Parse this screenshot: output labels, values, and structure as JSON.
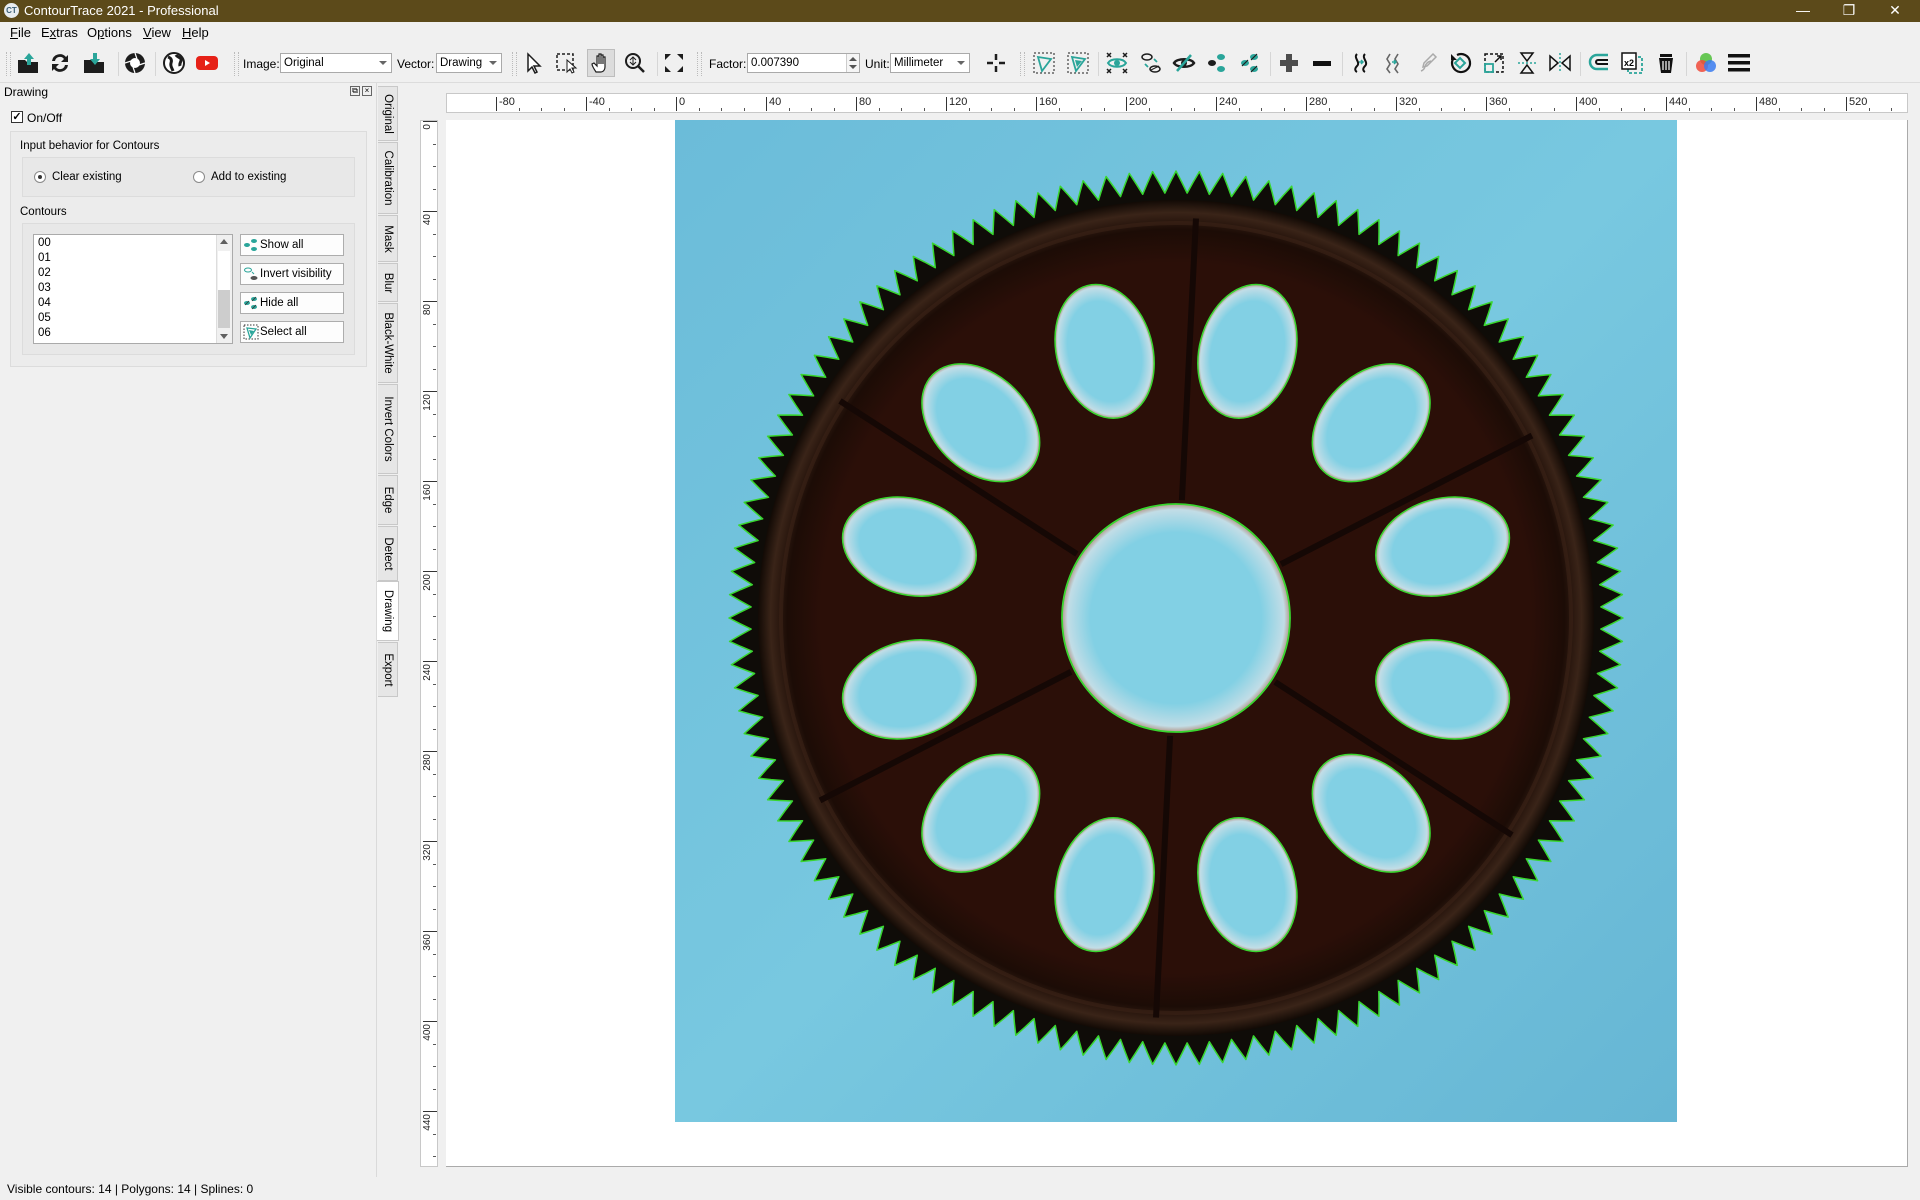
{
  "window": {
    "title": "ContourTrace 2021 - Professional",
    "app_icon_text": "CT",
    "controls": {
      "minimize": "—",
      "restore": "❐",
      "close": "✕"
    }
  },
  "menu": {
    "items": [
      {
        "label": "File",
        "mnemonic": "F"
      },
      {
        "label": "Extras",
        "mnemonic": "x"
      },
      {
        "label": "Options",
        "mnemonic": "p"
      },
      {
        "label": "View",
        "mnemonic": "V"
      },
      {
        "label": "Help",
        "mnemonic": "H"
      }
    ]
  },
  "toolbar": {
    "image_label": "Image:",
    "image_value": "Original",
    "vector_label": "Vector:",
    "vector_value": "Drawing",
    "factor_label": "Factor:",
    "factor_value": "0.007390",
    "unit_label": "Unit:",
    "unit_value": "Millimeter",
    "icons": [
      "open-image-icon",
      "reload-icon",
      "save-icon",
      "aperture-icon",
      "globe-icon",
      "youtube-icon",
      "pointer-icon",
      "select-rect-icon",
      "hand-pan-icon",
      "zoom-icon",
      "fit-to-window-icon",
      "crosshair-icon",
      "polygon-select-icon",
      "polygon-inner-select-icon",
      "show-all-contours-icon",
      "invert-visibility-icon",
      "hide-contour-icon",
      "show-contour-points-icon",
      "hide-contour-points-icon",
      "add-icon",
      "remove-icon",
      "spline-convert-icon",
      "polygon-convert-icon",
      "edit-curve-icon",
      "rotate-icon",
      "scale-icon",
      "flip-vertical-icon",
      "flip-horizontal-icon",
      "offset-icon",
      "duplicate-icon",
      "delete-icon",
      "color-icon",
      "menu-icon"
    ],
    "active_tool": "hand-pan-icon"
  },
  "panel": {
    "title": "Drawing",
    "onoff_label": "On/Off",
    "onoff_checked": true,
    "input_behavior": {
      "title": "Input behavior for Contours",
      "options": [
        {
          "label": "Clear existing",
          "selected": true
        },
        {
          "label": "Add to existing",
          "selected": false
        }
      ]
    },
    "contours": {
      "title": "Contours",
      "items": [
        "00",
        "01",
        "02",
        "03",
        "04",
        "05",
        "06"
      ],
      "buttons": [
        {
          "label": "Show all",
          "icon": "show-all-icon"
        },
        {
          "label": "Invert visibility",
          "icon": "invert-visibility-icon"
        },
        {
          "label": "Hide all",
          "icon": "hide-all-icon"
        },
        {
          "label": "Select all",
          "icon": "select-all-icon"
        }
      ]
    }
  },
  "side_tabs": [
    {
      "label": "Original",
      "active": false
    },
    {
      "label": "Calibration",
      "active": false
    },
    {
      "label": "Mask",
      "active": false
    },
    {
      "label": "Blur",
      "active": false
    },
    {
      "label": "Black-White",
      "active": false
    },
    {
      "label": "Invert Colors",
      "active": false
    },
    {
      "label": "Edge",
      "active": false
    },
    {
      "label": "Detect",
      "active": false
    },
    {
      "label": "Drawing",
      "active": true
    },
    {
      "label": "Export",
      "active": false
    }
  ],
  "rulers": {
    "horizontal": [
      "-80",
      "-40",
      "0",
      "40",
      "80",
      "120",
      "160",
      "200",
      "240",
      "280",
      "320",
      "360",
      "400",
      "440",
      "480",
      "520"
    ],
    "vertical": [
      "0",
      "40",
      "80",
      "120",
      "160",
      "200",
      "240",
      "280",
      "320",
      "360",
      "400",
      "440"
    ]
  },
  "canvas": {
    "image_description": "Gear with 12 oval holes and central circular hole on blue background, contours traced in green",
    "contour_color": "#39d62f",
    "background_color": "#6bbcd8",
    "gear_color": "#2a0f08",
    "gear_teeth": 120,
    "oval_holes": 12
  },
  "status": {
    "text": "Visible contours: 14  |  Polygons: 14  |  Splines: 0"
  }
}
